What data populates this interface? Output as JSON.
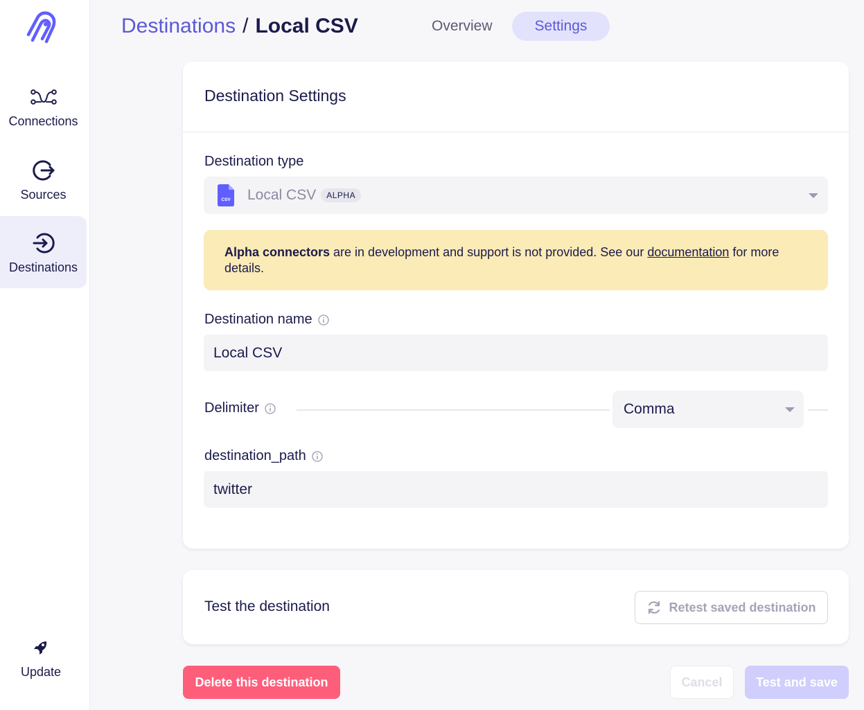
{
  "sidebar": {
    "logo": "airbyte-logo-icon",
    "items": [
      {
        "label": "Connections",
        "icon": "connections-icon",
        "active": false
      },
      {
        "label": "Sources",
        "icon": "sources-icon",
        "active": false
      },
      {
        "label": "Destinations",
        "icon": "destinations-icon",
        "active": true
      }
    ],
    "update": {
      "label": "Update",
      "icon": "rocket-icon"
    }
  },
  "header": {
    "breadcrumb_parent": "Destinations",
    "breadcrumb_separator": "/",
    "breadcrumb_current": "Local CSV",
    "tabs": [
      {
        "label": "Overview",
        "active": false
      },
      {
        "label": "Settings",
        "active": true
      }
    ]
  },
  "settings_card": {
    "title": "Destination Settings",
    "destination_type": {
      "label": "Destination type",
      "value": "Local CSV",
      "badge": "ALPHA",
      "icon": "csv-file-icon",
      "icon_text": "CSV"
    },
    "alert": {
      "bold": "Alpha connectors",
      "text_before_link": " are in development and support is not provided. See our ",
      "link": "documentation",
      "text_after_link": " for more details."
    },
    "destination_name": {
      "label": "Destination name",
      "value": "Local CSV"
    },
    "delimiter": {
      "label": "Delimiter",
      "value": "Comma"
    },
    "destination_path": {
      "label": "destination_path",
      "value": "twitter"
    }
  },
  "test_card": {
    "title": "Test the destination",
    "retest_button": "Retest saved destination"
  },
  "footer": {
    "delete_button": "Delete this destination",
    "cancel_button": "Cancel",
    "save_button": "Test and save"
  },
  "colors": {
    "accent": "#5b59d6",
    "danger": "#ff5e7b",
    "alert_bg": "#fbebb7",
    "active_nav_bg": "#eeeefb"
  }
}
